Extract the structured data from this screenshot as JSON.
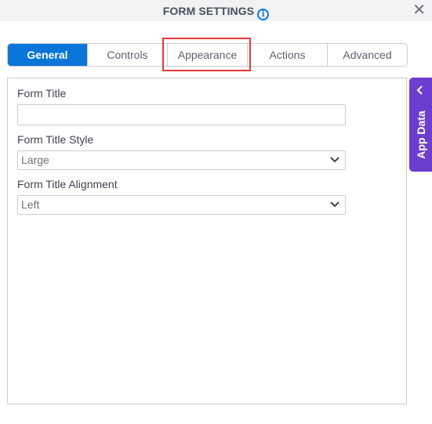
{
  "header": {
    "title": "FORM SETTINGS",
    "info_icon": "i",
    "close_icon": "✕"
  },
  "tabs": [
    {
      "label": "General",
      "active": true
    },
    {
      "label": "Controls",
      "active": false
    },
    {
      "label": "Appearance",
      "active": false,
      "highlighted": true
    },
    {
      "label": "Actions",
      "active": false
    },
    {
      "label": "Advanced",
      "active": false
    }
  ],
  "form": {
    "form_title": {
      "label": "Form Title",
      "value": ""
    },
    "form_title_style": {
      "label": "Form Title Style",
      "value": "Large"
    },
    "form_title_alignment": {
      "label": "Form Title Alignment",
      "value": "Left"
    }
  },
  "side_panel": {
    "label": "App Data"
  },
  "colors": {
    "accent": "#0a75d8",
    "highlight": "#e53935",
    "app_data": "#6c3dcf"
  }
}
